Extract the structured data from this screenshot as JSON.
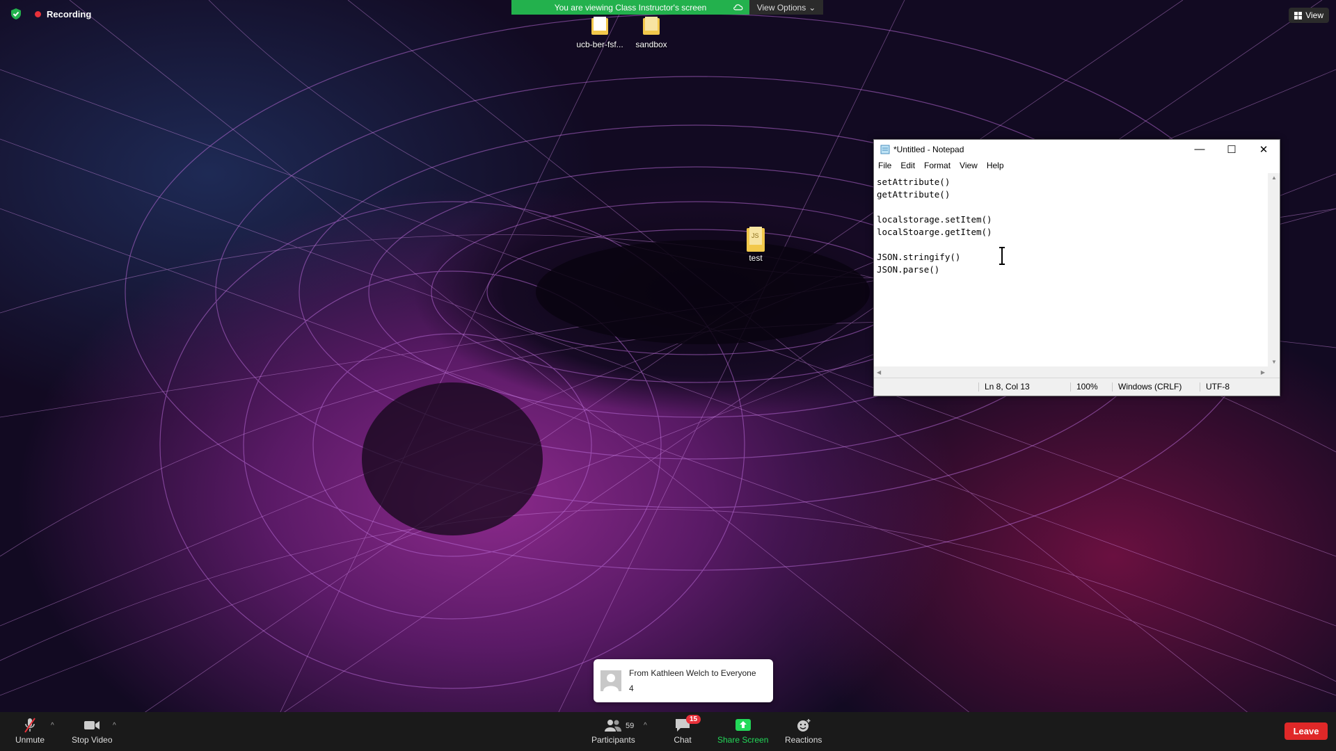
{
  "recording": {
    "label": "Recording"
  },
  "banner": {
    "message": "You are viewing Class Instructor's screen",
    "view_options": "View Options"
  },
  "view_button": {
    "label": "View"
  },
  "desktop_icons": [
    {
      "label": "ucb-ber-fsf..."
    },
    {
      "label": "sandbox"
    },
    {
      "label": "test",
      "badge": "JS"
    }
  ],
  "notepad": {
    "title": "*Untitled - Notepad",
    "menu": [
      "File",
      "Edit",
      "Format",
      "View",
      "Help"
    ],
    "content": "setAttribute()\ngetAttribute()\n\nlocalstorage.setItem()\nlocalStoarge.getItem()\n\nJSON.stringify()\nJSON.parse()",
    "status": {
      "position": "Ln 8, Col 13",
      "zoom": "100%",
      "line_ending": "Windows (CRLF)",
      "encoding": "UTF-8"
    }
  },
  "chat_toast": {
    "from": "From Kathleen Welch to Everyone",
    "message": "4"
  },
  "toolbar": {
    "unmute": "Unmute",
    "stop_video": "Stop Video",
    "participants": "Participants",
    "participants_count": "59",
    "chat": "Chat",
    "chat_badge": "15",
    "share_screen": "Share Screen",
    "reactions": "Reactions",
    "leave": "Leave"
  },
  "colors": {
    "banner_green": "#23b14d",
    "share_green": "#23d959",
    "leave_red": "#e02828"
  }
}
